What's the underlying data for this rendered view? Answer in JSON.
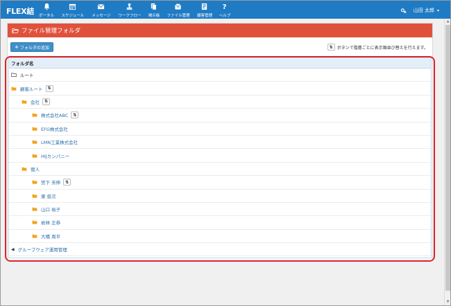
{
  "app": {
    "logo": "FLEX結",
    "nav": [
      {
        "label": "ポータル",
        "icon": "bell-icon"
      },
      {
        "label": "スケジュール",
        "icon": "calendar-icon"
      },
      {
        "label": "メッセージ",
        "icon": "envelope-icon"
      },
      {
        "label": "ワークフロー",
        "icon": "stamp-icon"
      },
      {
        "label": "掲示板",
        "icon": "bulletin-icon"
      },
      {
        "label": "ファイル管理",
        "icon": "files-icon"
      },
      {
        "label": "顧客管理",
        "icon": "customer-icon"
      },
      {
        "label": "ヘルプ",
        "icon": "help-icon"
      }
    ],
    "user": {
      "name": "山田 太郎",
      "icon": "settings-icon"
    },
    "colors": {
      "topbar": "#1f7bc4",
      "panel_header": "#e0513c",
      "folder": "#f0a31c",
      "link": "#2a6fad",
      "highlight_frame": "#d9242a"
    }
  },
  "panel": {
    "title": "ファイル管理フォルダ",
    "add_button": "フォルダの追加",
    "sort_hint": "ボタンで階層ごとに表示順並び替えを行えます。",
    "column_header": "フォルダ名"
  },
  "tree": [
    {
      "label": "ルート",
      "level": 0,
      "icon": "folder-open-outline-icon",
      "link": false,
      "sort": false
    },
    {
      "label": "顧客ルート",
      "level": 0,
      "icon": "folder-icon",
      "link": true,
      "sort": true
    },
    {
      "label": "会社",
      "level": 1,
      "icon": "folder-icon",
      "link": true,
      "sort": true
    },
    {
      "label": "株式会社ABC",
      "level": 2,
      "icon": "folder-icon",
      "link": true,
      "sort": true
    },
    {
      "label": "EFG株式会社",
      "level": 2,
      "icon": "folder-icon",
      "link": true,
      "sort": false
    },
    {
      "label": "LMN工業株式会社",
      "level": 2,
      "icon": "folder-icon",
      "link": true,
      "sort": false
    },
    {
      "label": "HIJカンパニー",
      "level": 2,
      "icon": "folder-icon",
      "link": true,
      "sort": false
    },
    {
      "label": "個人",
      "level": 1,
      "icon": "folder-icon",
      "link": true,
      "sort": false
    },
    {
      "label": "宮下 芳伸",
      "level": 2,
      "icon": "folder-icon",
      "link": true,
      "sort": true
    },
    {
      "label": "東 俊次",
      "level": 2,
      "icon": "folder-icon",
      "link": true,
      "sort": false
    },
    {
      "label": "山口 裕子",
      "level": 2,
      "icon": "folder-icon",
      "link": true,
      "sort": false
    },
    {
      "label": "岩林 正恭",
      "level": 2,
      "icon": "folder-icon",
      "link": true,
      "sort": false
    },
    {
      "label": "大橋 周平",
      "level": 2,
      "icon": "folder-icon",
      "link": true,
      "sort": false
    },
    {
      "label": "グループウェア運用管理",
      "level": 0,
      "icon": "caret-left-icon",
      "link": true,
      "sort": false
    }
  ]
}
